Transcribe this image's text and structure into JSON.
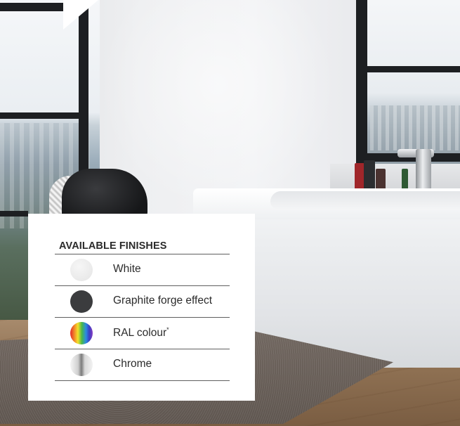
{
  "panel": {
    "title": "AVAILABLE FINISHES",
    "finishes": [
      {
        "label": "White",
        "swatch_color": "#eeeeee"
      },
      {
        "label": "Graphite forge effect",
        "swatch_color": "#3b3c3e"
      },
      {
        "label": "RAL colour",
        "mark": "*",
        "swatch_color": "rainbow"
      },
      {
        "label": "Chrome",
        "swatch_color": "chrome-gradient"
      }
    ]
  }
}
